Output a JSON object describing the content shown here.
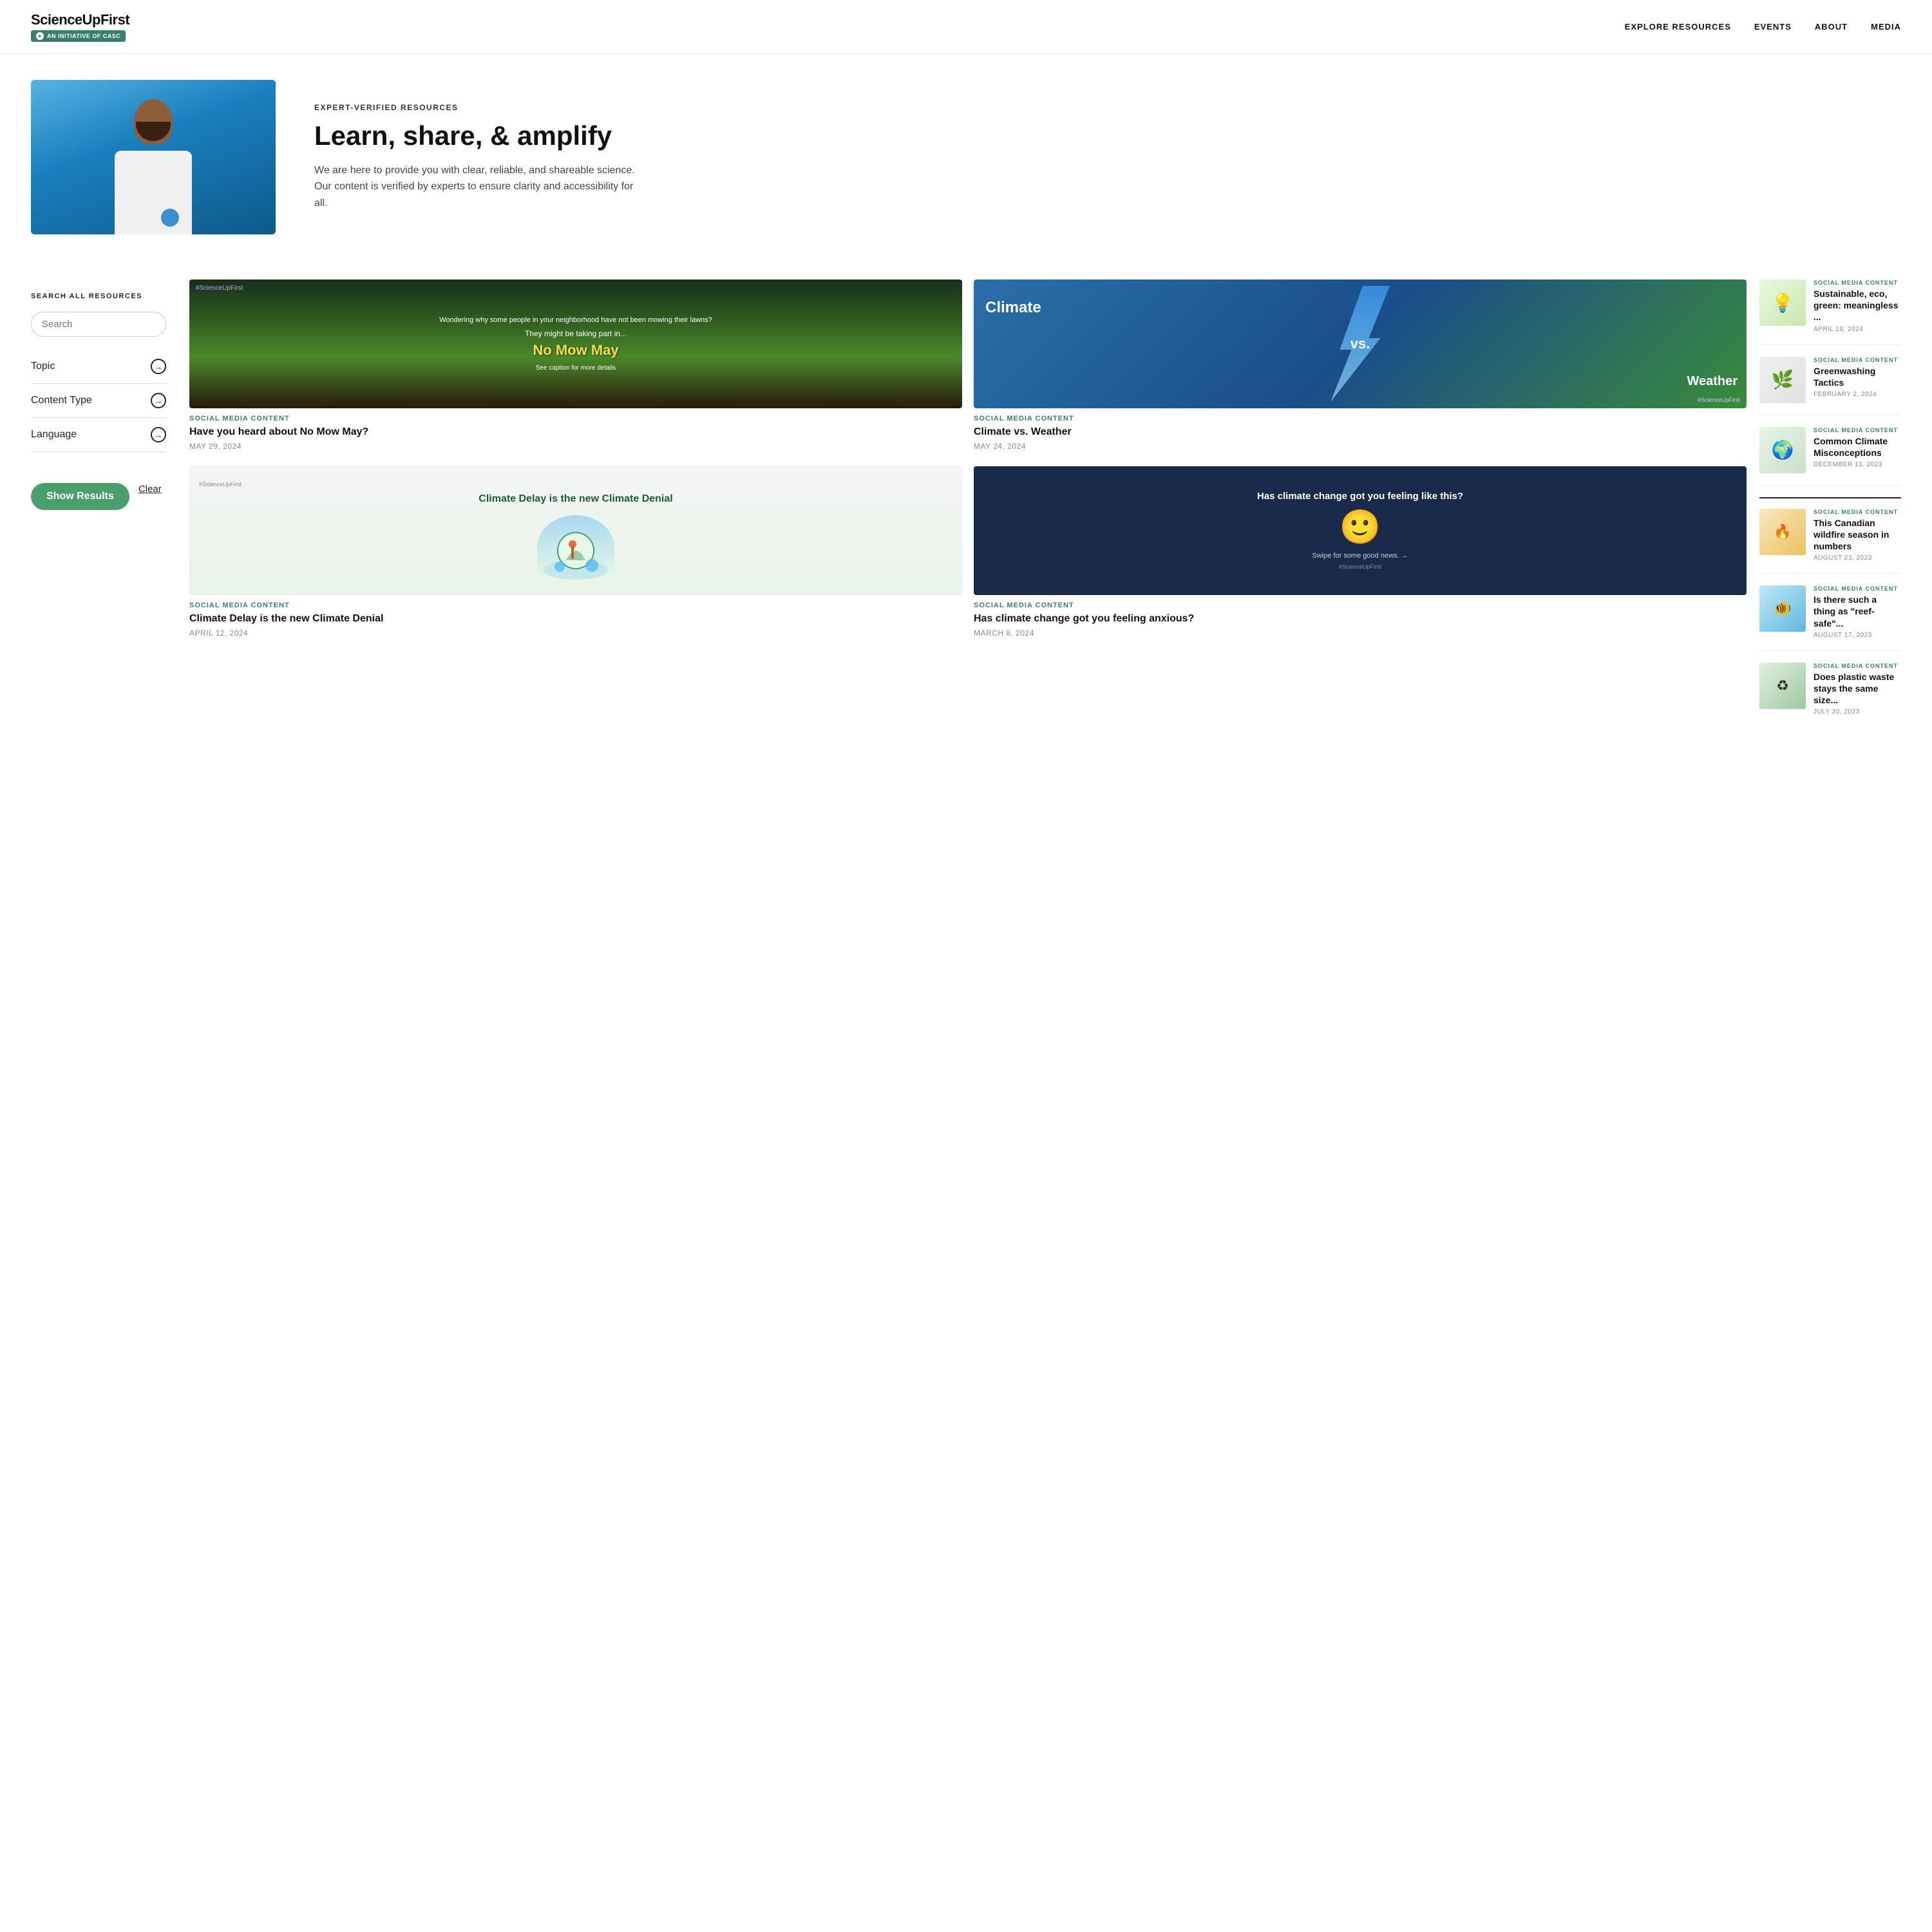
{
  "header": {
    "logo_name": "ScienceUpFirst",
    "logo_badge": "AN INITIATIVE OF CASC",
    "logo_icon": "⚙",
    "nav_items": [
      {
        "label": "EXPLORE RESOURCES"
      },
      {
        "label": "EVENTS"
      },
      {
        "label": "ABOUT"
      },
      {
        "label": "MEDIA"
      }
    ]
  },
  "hero": {
    "eyebrow": "EXPERT-VERIFIED RESOURCES",
    "title": "Learn, share, & amplify",
    "description": "We are here to provide you with clear, reliable, and shareable science. Our content is verified by experts to ensure clarity and accessibility for all."
  },
  "sidebar": {
    "title": "SEARCH ALL RESOURCES",
    "search_placeholder": "Search",
    "filters": [
      {
        "label": "Topic"
      },
      {
        "label": "Content Type"
      },
      {
        "label": "Language"
      }
    ],
    "show_results_label": "Show Results",
    "clear_label": "Clear"
  },
  "main_cards": [
    {
      "id": "nomow",
      "tag": "SOCIAL MEDIA CONTENT",
      "hashtag": "#ScienceUpFirst",
      "top_text": "Wondering why some people in your neighborhood have not been mowing their lawns?",
      "mid_text": "They might be taking part in...",
      "title_text": "No Mow May",
      "sub_text": "See caption for more details",
      "card_title": "Have you heard about No Mow May?",
      "date": "MAY 29, 2024"
    },
    {
      "id": "climate-weather",
      "tag": "SOCIAL MEDIA CONTENT",
      "left": "Climate",
      "vs": "vs.",
      "right": "Weather",
      "hashtag": "#ScienceUpFirst",
      "card_title": "Climate vs. Weather",
      "date": "MAY 24, 2024"
    },
    {
      "id": "climate-delay",
      "tag": "SOCIAL MEDIA CONTENT",
      "hashtag": "#ScienceUpFirst",
      "delay_title": "Climate Delay is the new Climate Denial",
      "card_title": "Climate Delay is the new Climate Denial",
      "date": "APRIL 12, 2024"
    },
    {
      "id": "climate-emoji",
      "tag": "SOCIAL MEDIA CONTENT",
      "emoji_text": "Has climate change got you feeling like this?",
      "emoji": "🙂",
      "swipe": "Swipe for some good news. →",
      "hashtag": "#ScienceUpFirst",
      "card_title": "Has climate change got you feeling anxious?",
      "date": "MARCH 8, 2024"
    }
  ],
  "side_cards": [
    {
      "tag": "SOCIAL MEDIA CONTENT",
      "title": "Sustainable, eco, green: meaningless ...",
      "date": "APRIL 19, 2024",
      "img_type": "sustainable",
      "icon": "💡"
    },
    {
      "tag": "SOCIAL MEDIA CONTENT",
      "title": "Greenwashing Tactics",
      "date": "FEBRUARY 2, 2024",
      "img_type": "greenwash",
      "icon": "🌿"
    },
    {
      "tag": "SOCIAL MEDIA CONTENT",
      "title": "Common Climate Misconceptions",
      "date": "DECEMBER 13, 2023",
      "img_type": "misconceptions",
      "icon": "🌍"
    },
    {
      "tag": "SOCIAL MEDIA CONTENT",
      "title": "This Canadian wildfire season in numbers",
      "date": "AUGUST 23, 2023",
      "img_type": "wildfire",
      "icon": "🔥"
    },
    {
      "tag": "SOCIAL MEDIA CONTENT",
      "title": "Is there such a thing as \"reef-safe\"...",
      "date": "AUGUST 17, 2023",
      "img_type": "reef",
      "icon": "🐠"
    },
    {
      "tag": "SOCIAL MEDIA CONTENT",
      "title": "Does plastic waste stays the same size...",
      "date": "JULY 20, 2023",
      "img_type": "plastic",
      "icon": "♻"
    }
  ]
}
